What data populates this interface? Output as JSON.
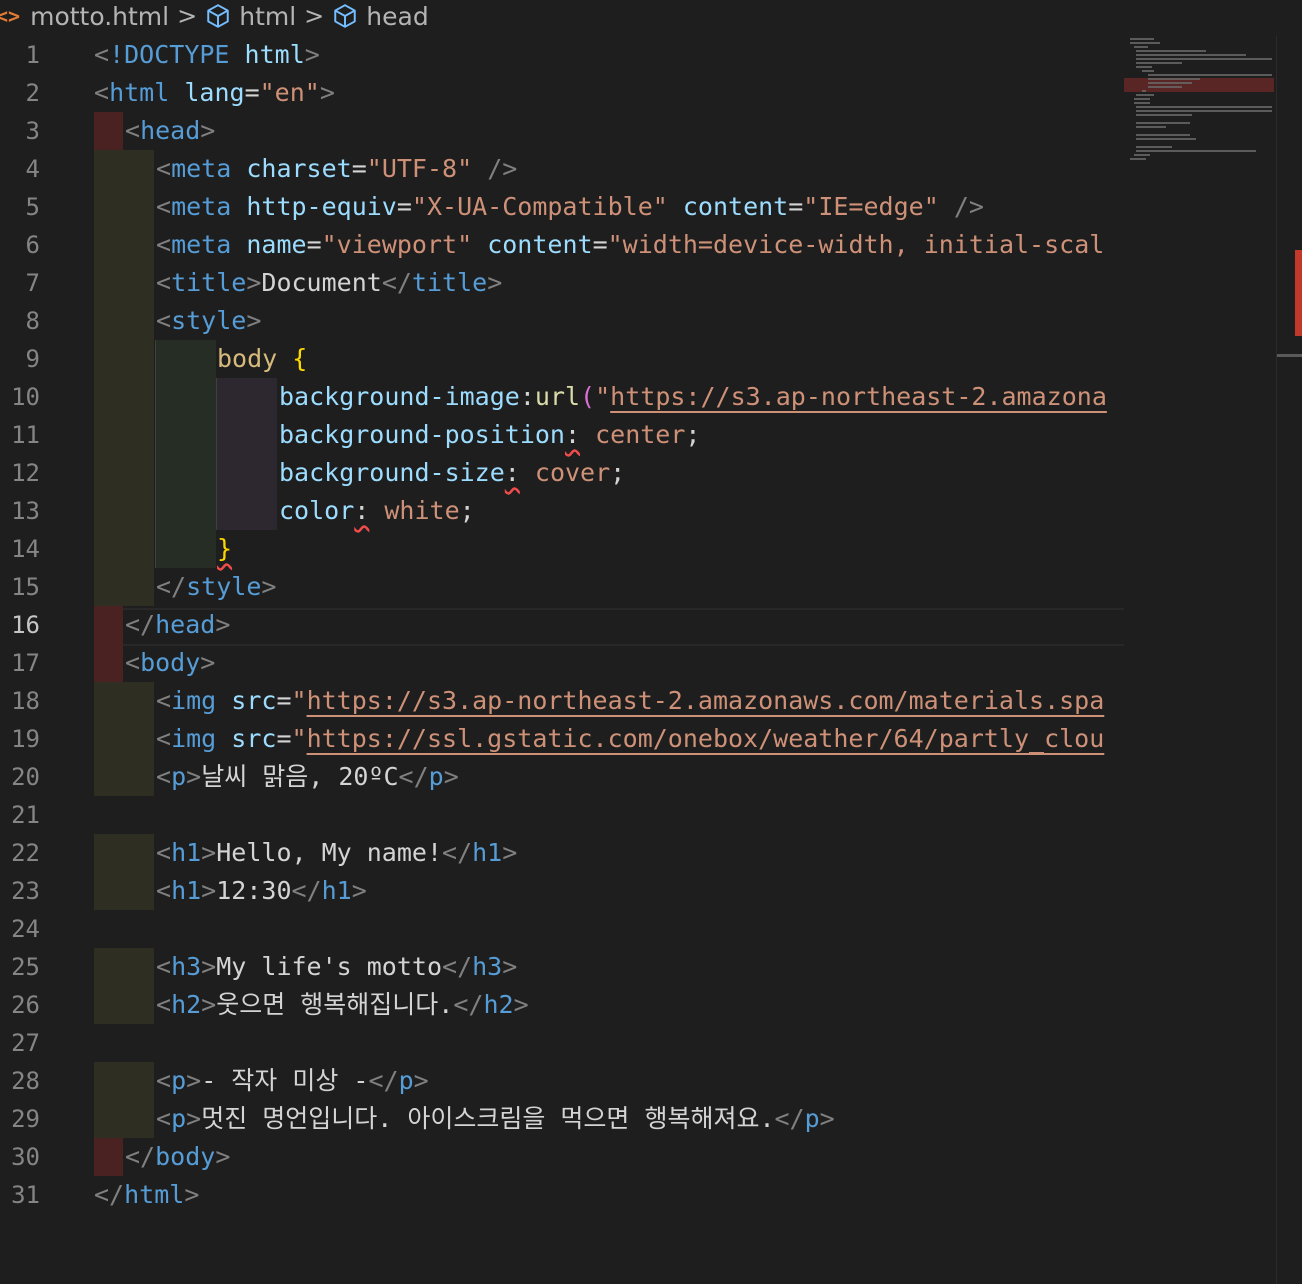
{
  "breadcrumb": {
    "file_icon": "<>",
    "file": "motto.html",
    "items": [
      "html",
      "head"
    ],
    "separator": ">"
  },
  "editor": {
    "active_line": 16,
    "line_numbers": [
      "1",
      "2",
      "3",
      "4",
      "5",
      "6",
      "7",
      "8",
      "9",
      "10",
      "11",
      "12",
      "13",
      "14",
      "15",
      "16",
      "17",
      "18",
      "19",
      "20",
      "21",
      "22",
      "23",
      "24",
      "25",
      "26",
      "27",
      "28",
      "29",
      "30",
      "31"
    ],
    "code": {
      "l1": [
        "<",
        "!DOCTYPE",
        " ",
        "html",
        ">"
      ],
      "l2": [
        "<",
        "html",
        " ",
        "lang",
        "=",
        "\"en\"",
        ">"
      ],
      "l3": [
        "<",
        "head",
        ">"
      ],
      "l4": [
        "<",
        "meta",
        " ",
        "charset",
        "=",
        "\"UTF-8\"",
        " ",
        "/>"
      ],
      "l5": [
        "<",
        "meta",
        " ",
        "http-equiv",
        "=",
        "\"X-UA-Compatible\"",
        " ",
        "content",
        "=",
        "\"IE=edge\"",
        " ",
        "/>"
      ],
      "l6": [
        "<",
        "meta",
        " ",
        "name",
        "=",
        "\"viewport\"",
        " ",
        "content",
        "=",
        "\"width=device-width, initial-scal"
      ],
      "l7": [
        "<",
        "title",
        ">",
        "Document",
        "</",
        "title",
        ">"
      ],
      "l8": [
        "<",
        "style",
        ">"
      ],
      "l9": [
        "body",
        " ",
        "{"
      ],
      "l10": [
        "background-image",
        ":",
        "url",
        "(",
        "\"",
        "https://s3.ap-northeast-2.amazona"
      ],
      "l11": [
        "background-position",
        ":",
        " center",
        ";"
      ],
      "l12": [
        "background-size",
        ":",
        " cover",
        ";"
      ],
      "l13": [
        "color",
        ":",
        " white",
        ";"
      ],
      "l14": [
        "}"
      ],
      "l15": [
        "</",
        "style",
        ">"
      ],
      "l16": [
        "</",
        "head",
        ">"
      ],
      "l17": [
        "<",
        "body",
        ">"
      ],
      "l18": [
        "<",
        "img",
        " ",
        "src",
        "=",
        "\"",
        "https://s3.ap-northeast-2.amazonaws.com/materials.spa"
      ],
      "l19": [
        "<",
        "img",
        " ",
        "src",
        "=",
        "\"",
        "https://ssl.gstatic.com/onebox/weather/64/partly_clou"
      ],
      "l20": [
        "<",
        "p",
        ">",
        "날씨 맑음, 20ºC",
        "</",
        "p",
        ">"
      ],
      "l22": [
        "<",
        "h1",
        ">",
        "Hello, My name!",
        "</",
        "h1",
        ">"
      ],
      "l23": [
        "<",
        "h1",
        ">",
        "12:30",
        "</",
        "h1",
        ">"
      ],
      "l25": [
        "<",
        "h3",
        ">",
        "My life's motto",
        "</",
        "h3",
        ">"
      ],
      "l26": [
        "<",
        "h2",
        ">",
        "웃으면 행복해집니다.",
        "</",
        "h2",
        ">"
      ],
      "l28": [
        "<",
        "p",
        ">",
        "- 작자 미상 -",
        "</",
        "p",
        ">"
      ],
      "l29": [
        "<",
        "p",
        ">",
        "멋진 명언입니다. 아이스크림을 먹으면 행복해져요.",
        "</",
        "p",
        ">"
      ],
      "l30": [
        "</",
        "body",
        ">"
      ],
      "l31": [
        "</",
        "html",
        ">"
      ]
    }
  },
  "colors": {
    "background": "#1e1e1e",
    "tag": "#569cd6",
    "attribute": "#9cdcfe",
    "string": "#ce9178",
    "selector": "#d7ba7d",
    "bracket_highlight": "#ffd700",
    "error_squiggle": "#f14c4c",
    "file_icon": "#e37933"
  }
}
